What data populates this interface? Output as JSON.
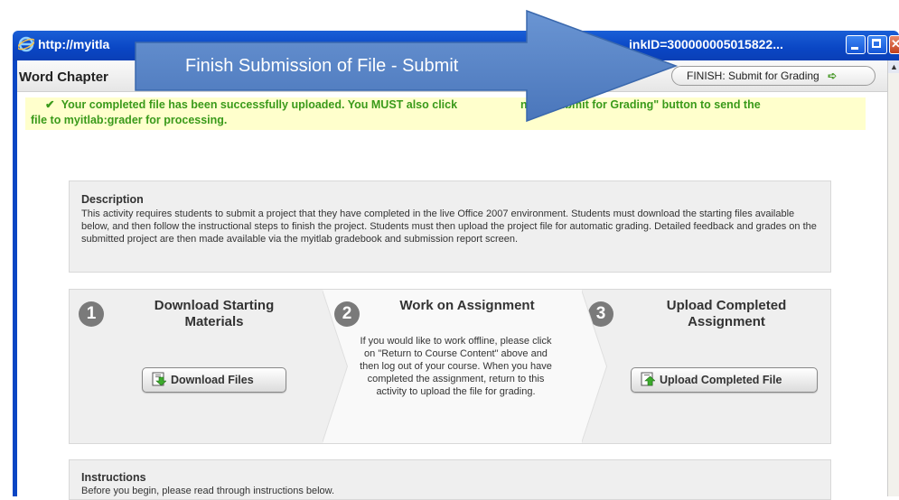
{
  "window": {
    "title_left": "http://myitla",
    "title_right": "inkID=300000005015822...",
    "icons": [
      "ie-icon",
      "minimize-icon",
      "maximize-icon",
      "close-icon"
    ]
  },
  "toolbar": {
    "page_title": "Word Chapter",
    "finish_button": "FINISH: Submit for Grading"
  },
  "callout": {
    "text": "Finish Submission of File - Submit"
  },
  "notice": {
    "line1": "Your completed file has been successfully uploaded. You MUST also click",
    "line1_tail": "nish: Submit for Grading\" button to send the",
    "line2": "file to myitlab:grader for processing."
  },
  "description": {
    "title": "Description",
    "text": "This activity requires students to submit a project that they have completed in the live Office 2007 environment. Students must download the starting files available below, and then follow the instructional steps to finish the project. Students must then upload the project file for automatic grading. Detailed feedback and grades on the submitted project are then made available via the myitlab gradebook and submission report screen."
  },
  "steps": [
    {
      "number": "1",
      "title": "Download Starting Materials",
      "button": "Download Files"
    },
    {
      "number": "2",
      "title": "Work on Assignment",
      "text": "If you would like to work offline, please click on \"Return to Course Content\" above and then log out of your course. When you have completed the assignment, return to this activity to upload the file for grading."
    },
    {
      "number": "3",
      "title": "Upload Completed Assignment",
      "button": "Upload Completed File"
    }
  ],
  "instructions": {
    "title": "Instructions",
    "text": "Before you begin, please read through instructions below."
  },
  "colors": {
    "titlebar": "#0a46c4",
    "notice_bg": "#ffffcc",
    "notice_text": "#3a9a1a",
    "callout_blue": "#5b86c8"
  }
}
